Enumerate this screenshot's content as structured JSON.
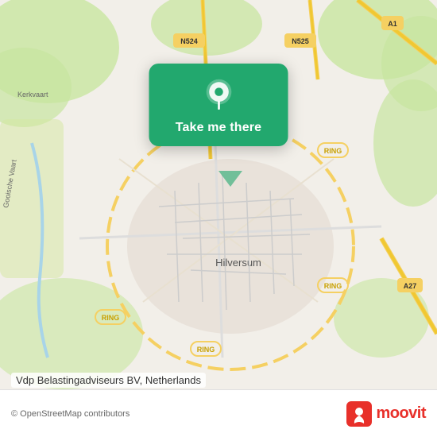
{
  "map": {
    "background_color": "#f2efe9",
    "center_city": "Hilversum",
    "country": "Netherlands"
  },
  "card": {
    "label": "Take me there",
    "pin_color": "#ffffff"
  },
  "bottom_bar": {
    "copyright": "© OpenStreetMap contributors",
    "location_name": "Vdp Belastingadviseurs BV, Netherlands",
    "moovit_label": "moovit"
  }
}
